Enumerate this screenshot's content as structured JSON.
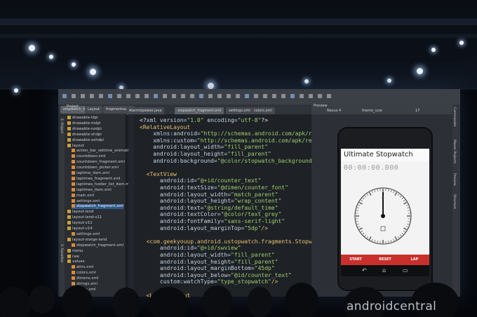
{
  "ide": {
    "tabs": [
      {
        "label": "stopwatch_fragment",
        "active": true
      },
      {
        "label": "Layout"
      },
      {
        "label": "fragmentsamp"
      },
      {
        "label": "AlarmUpdater.java"
      },
      {
        "label": "stopwatch_fragment.xml",
        "active": true
      },
      {
        "label": "settings.xml"
      },
      {
        "label": "colors.xml"
      }
    ],
    "sidebar_header": "Project",
    "sidebar_side_labels": [
      "1: Project",
      "2: Favorites"
    ],
    "tree": [
      {
        "label": "drawable-ldpi",
        "kind": "folder"
      },
      {
        "label": "drawable-mdpi",
        "kind": "folder"
      },
      {
        "label": "drawable-nodpi",
        "kind": "folder"
      },
      {
        "label": "drawable-xhdpi",
        "kind": "folder"
      },
      {
        "label": "drawable-xxhdpi",
        "kind": "folder"
      },
      {
        "label": "layout",
        "kind": "folder"
      },
      {
        "label": "action_bar_settime_animatio",
        "kind": "file"
      },
      {
        "label": "countdown.xml",
        "kind": "file"
      },
      {
        "label": "countdown_fragment.xml",
        "kind": "file"
      },
      {
        "label": "countdown_picker.xml",
        "kind": "file"
      },
      {
        "label": "laptime_item.xml",
        "kind": "file"
      },
      {
        "label": "laptimes_fragment.xml",
        "kind": "file"
      },
      {
        "label": "laptimes_holder_list_item.m",
        "kind": "file"
      },
      {
        "label": "laptimes_item.xml",
        "kind": "file"
      },
      {
        "label": "main.xml",
        "kind": "file"
      },
      {
        "label": "settings.xml",
        "kind": "file"
      },
      {
        "label": "stopwatch_fragment.xml",
        "kind": "file",
        "selected": true
      },
      {
        "label": "layout-land",
        "kind": "folder"
      },
      {
        "label": "layout-land-v11",
        "kind": "folder"
      },
      {
        "label": "layout-v11",
        "kind": "folder"
      },
      {
        "label": "layout-v14",
        "kind": "folder"
      },
      {
        "label": "settings.xml",
        "kind": "file"
      },
      {
        "label": "layout-xlarge-land",
        "kind": "folder"
      },
      {
        "label": "stopwatch_fragment.xml",
        "kind": "file"
      },
      {
        "label": "menu",
        "kind": "folder"
      },
      {
        "label": "raw",
        "kind": "folder"
      },
      {
        "label": "values",
        "kind": "folder"
      },
      {
        "label": "attrs.xml",
        "kind": "file"
      },
      {
        "label": "colors.xml",
        "kind": "file"
      },
      {
        "label": "dimens.xml",
        "kind": "file"
      },
      {
        "label": "strings.xml",
        "kind": "file"
      },
      {
        "label": "styles.xml",
        "kind": "file"
      }
    ],
    "code_lines": [
      [
        [
          "p",
          "<?"
        ],
        [
          "a",
          "xml version="
        ],
        [
          "s",
          "\"1.0\""
        ],
        [
          "a",
          " encoding="
        ],
        [
          "s",
          "\"utf-8\""
        ],
        [
          "p",
          "?>"
        ]
      ],
      [
        [
          "t",
          "<RelativeLayout"
        ]
      ],
      [
        [
          "a",
          "    xmlns:android="
        ],
        [
          "s",
          "\"http://schemas.android.com/apk/res/and"
        ]
      ],
      [
        [
          "a",
          "    xmlns:custom="
        ],
        [
          "s",
          "\"http://schemas.android.com/apk/res-auto"
        ]
      ],
      [
        [
          "a",
          "    android:layout_width="
        ],
        [
          "s",
          "\"fill_parent\""
        ]
      ],
      [
        [
          "a",
          "    android:layout_height="
        ],
        [
          "s",
          "\"fill_parent\""
        ]
      ],
      [
        [
          "a",
          "    android:background="
        ],
        [
          "s",
          "\"@color/stopwatch_background\""
        ],
        [
          "t",
          ">"
        ]
      ],
      [
        [
          "p",
          ""
        ]
      ],
      [
        [
          "t",
          "  <TextView"
        ]
      ],
      [
        [
          "a",
          "      android:id="
        ],
        [
          "s",
          "\"@+id/counter_text\""
        ]
      ],
      [
        [
          "a",
          "      android:textSize="
        ],
        [
          "s",
          "\"@dimen/counter_font\""
        ]
      ],
      [
        [
          "a",
          "      android:layout_width="
        ],
        [
          "s",
          "\"match_parent\""
        ]
      ],
      [
        [
          "a",
          "      android:layout_height="
        ],
        [
          "s",
          "\"wrap_content\""
        ]
      ],
      [
        [
          "a",
          "      android:text="
        ],
        [
          "s",
          "\"@string/default_time\""
        ]
      ],
      [
        [
          "a",
          "      android:textColor="
        ],
        [
          "s",
          "\"@color/text_grey\""
        ]
      ],
      [
        [
          "a",
          "      android:fontFamily="
        ],
        [
          "s",
          "\"sans-serif-light\""
        ]
      ],
      [
        [
          "a",
          "      android:layout_marginTop="
        ],
        [
          "s",
          "\"5dp\""
        ],
        [
          "t",
          "/>"
        ]
      ],
      [
        [
          "p",
          ""
        ]
      ],
      [
        [
          "t",
          "  <com.geekyouup.android.ustopwatch.fragments.Stopwatc"
        ]
      ],
      [
        [
          "a",
          "      android:id="
        ],
        [
          "s",
          "\"@+id/swview\""
        ]
      ],
      [
        [
          "a",
          "      android:layout_width="
        ],
        [
          "s",
          "\"fill_parent\""
        ]
      ],
      [
        [
          "a",
          "      android:layout_height="
        ],
        [
          "s",
          "\"fill_parent\""
        ]
      ],
      [
        [
          "a",
          "      android:layout_marginBottom="
        ],
        [
          "s",
          "\"45dp\""
        ]
      ],
      [
        [
          "a",
          "      android:layout_below="
        ],
        [
          "s",
          "\"@id/counter_text\""
        ]
      ],
      [
        [
          "a",
          "      custom:watchType="
        ],
        [
          "s",
          "\"type_stopwatch\""
        ],
        [
          "t",
          "/>"
        ]
      ],
      [
        [
          "p",
          ""
        ]
      ],
      [
        [
          "t",
          "  <LinearLayout"
        ]
      ]
    ],
    "preview_header": "Preview",
    "preview_device": "Nexus 4",
    "preview_theme": "theme_ucw",
    "preview_api": "17",
    "right_strip_labels": [
      "Commander",
      "Maven Projects",
      "Preview",
      "Structure"
    ]
  },
  "app": {
    "title": "Ultimate Stopwatch",
    "time": "00:00:00.000",
    "buttons": [
      "START",
      "RESET",
      "LAP"
    ],
    "dial_number": "0"
  },
  "watermark": "androidcentral",
  "colors": {
    "accent": "#c9302c",
    "xml_tag": "#e8bf6a",
    "xml_string": "#9fce6b"
  }
}
